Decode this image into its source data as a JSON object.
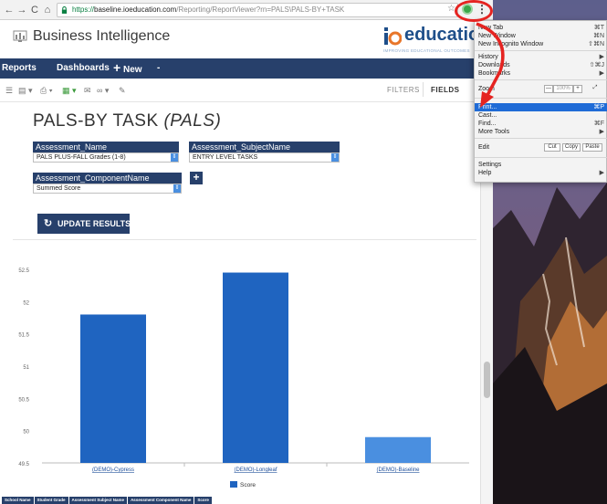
{
  "browser": {
    "url_scheme": "https://",
    "url_host": "baseline.ioeducation.com",
    "url_path": "/Reporting/ReportViewer?rn=PALS\\PALS-BY+TASK",
    "back_glyph": "←",
    "forward_glyph": "→",
    "reload_glyph": "C",
    "home_glyph": "⌂",
    "star_glyph": "☆",
    "kebab_glyph": "⋮"
  },
  "app": {
    "title": "Business Intelligence",
    "brand_word": "education",
    "brand_tagline": "IMPROVING EDUCATIONAL OUTCOMES"
  },
  "nav": {
    "reports": "Reports",
    "dashboards": "Dashboards",
    "new_plus": "+",
    "new_label": "New",
    "more": "-"
  },
  "toolbar": {
    "tools": [
      "☰",
      "▤ ▾",
      "⎙ ▾",
      "▦ ▾",
      "✉",
      "∞ ▾",
      "✎"
    ],
    "tab_filters": "FILTERS",
    "tab_fields": "FIELDS"
  },
  "report": {
    "title_main": "PALS-BY TASK",
    "title_italic": "(PALS)",
    "params": [
      {
        "label": "Assessment_Name",
        "value": "PALS PLUS-FALL Grades (1-8)"
      },
      {
        "label": "Assessment_SubjectName",
        "value": "ENTRY LEVEL TASKS"
      },
      {
        "label": "Assessment_ComponentName",
        "value": "Summed Score"
      }
    ],
    "add_glyph": "+",
    "caret_glyph": "⇕",
    "update_icon": "↻",
    "update_label": "UPDATE RESULTS"
  },
  "colors": {
    "navy": "#27406b",
    "bar_primary": "#1f64c0",
    "bar_secondary": "#4a8fe0",
    "highlight": "#1f6bd6",
    "annotation_red": "#e52421"
  },
  "chart_data": {
    "type": "bar",
    "categories": [
      "(DEMO)-Cypress",
      "(DEMO)-Longleaf",
      "(DEMO)-Baseline"
    ],
    "series": [
      {
        "name": "Score",
        "values": [
          51.8,
          52.45,
          49.9
        ]
      }
    ],
    "ylim": [
      49.5,
      52.5
    ],
    "yticks": [
      "52.5",
      "52",
      "51.5",
      "51",
      "50.5",
      "50",
      "49.5"
    ],
    "ytick_values": [
      52.5,
      52,
      51.5,
      51,
      50.5,
      50,
      49.5
    ],
    "grid": false,
    "legend": "bottom"
  },
  "table_headers": [
    "School Name",
    "Student Grade",
    "Assessment Subject Name",
    "Assessment Component Name",
    "Score"
  ],
  "menu": {
    "items": [
      {
        "label": "New Tab",
        "shortcut": "⌘T"
      },
      {
        "label": "New Window",
        "shortcut": "⌘N"
      },
      {
        "label": "New Incognito Window",
        "shortcut": "⇧⌘N"
      },
      {
        "label": "History",
        "shortcut": "▶"
      },
      {
        "label": "Downloads",
        "shortcut": "⇧⌘J"
      },
      {
        "label": "Bookmarks",
        "shortcut": "▶"
      },
      {
        "label": "Zoom",
        "shortcut": ""
      },
      {
        "label": "Print...",
        "shortcut": "⌘P"
      },
      {
        "label": "Cast...",
        "shortcut": ""
      },
      {
        "label": "Find...",
        "shortcut": "⌘F"
      },
      {
        "label": "More Tools",
        "shortcut": "▶"
      },
      {
        "label": "Edit",
        "shortcut": ""
      },
      {
        "label": "Settings",
        "shortcut": ""
      },
      {
        "label": "Help",
        "shortcut": "▶"
      }
    ],
    "zoom_minus": "—",
    "zoom_value": "100%",
    "zoom_plus": "+",
    "zoom_fullscreen": "⤢",
    "edit_cut": "Cut",
    "edit_copy": "Copy",
    "edit_paste": "Paste"
  }
}
